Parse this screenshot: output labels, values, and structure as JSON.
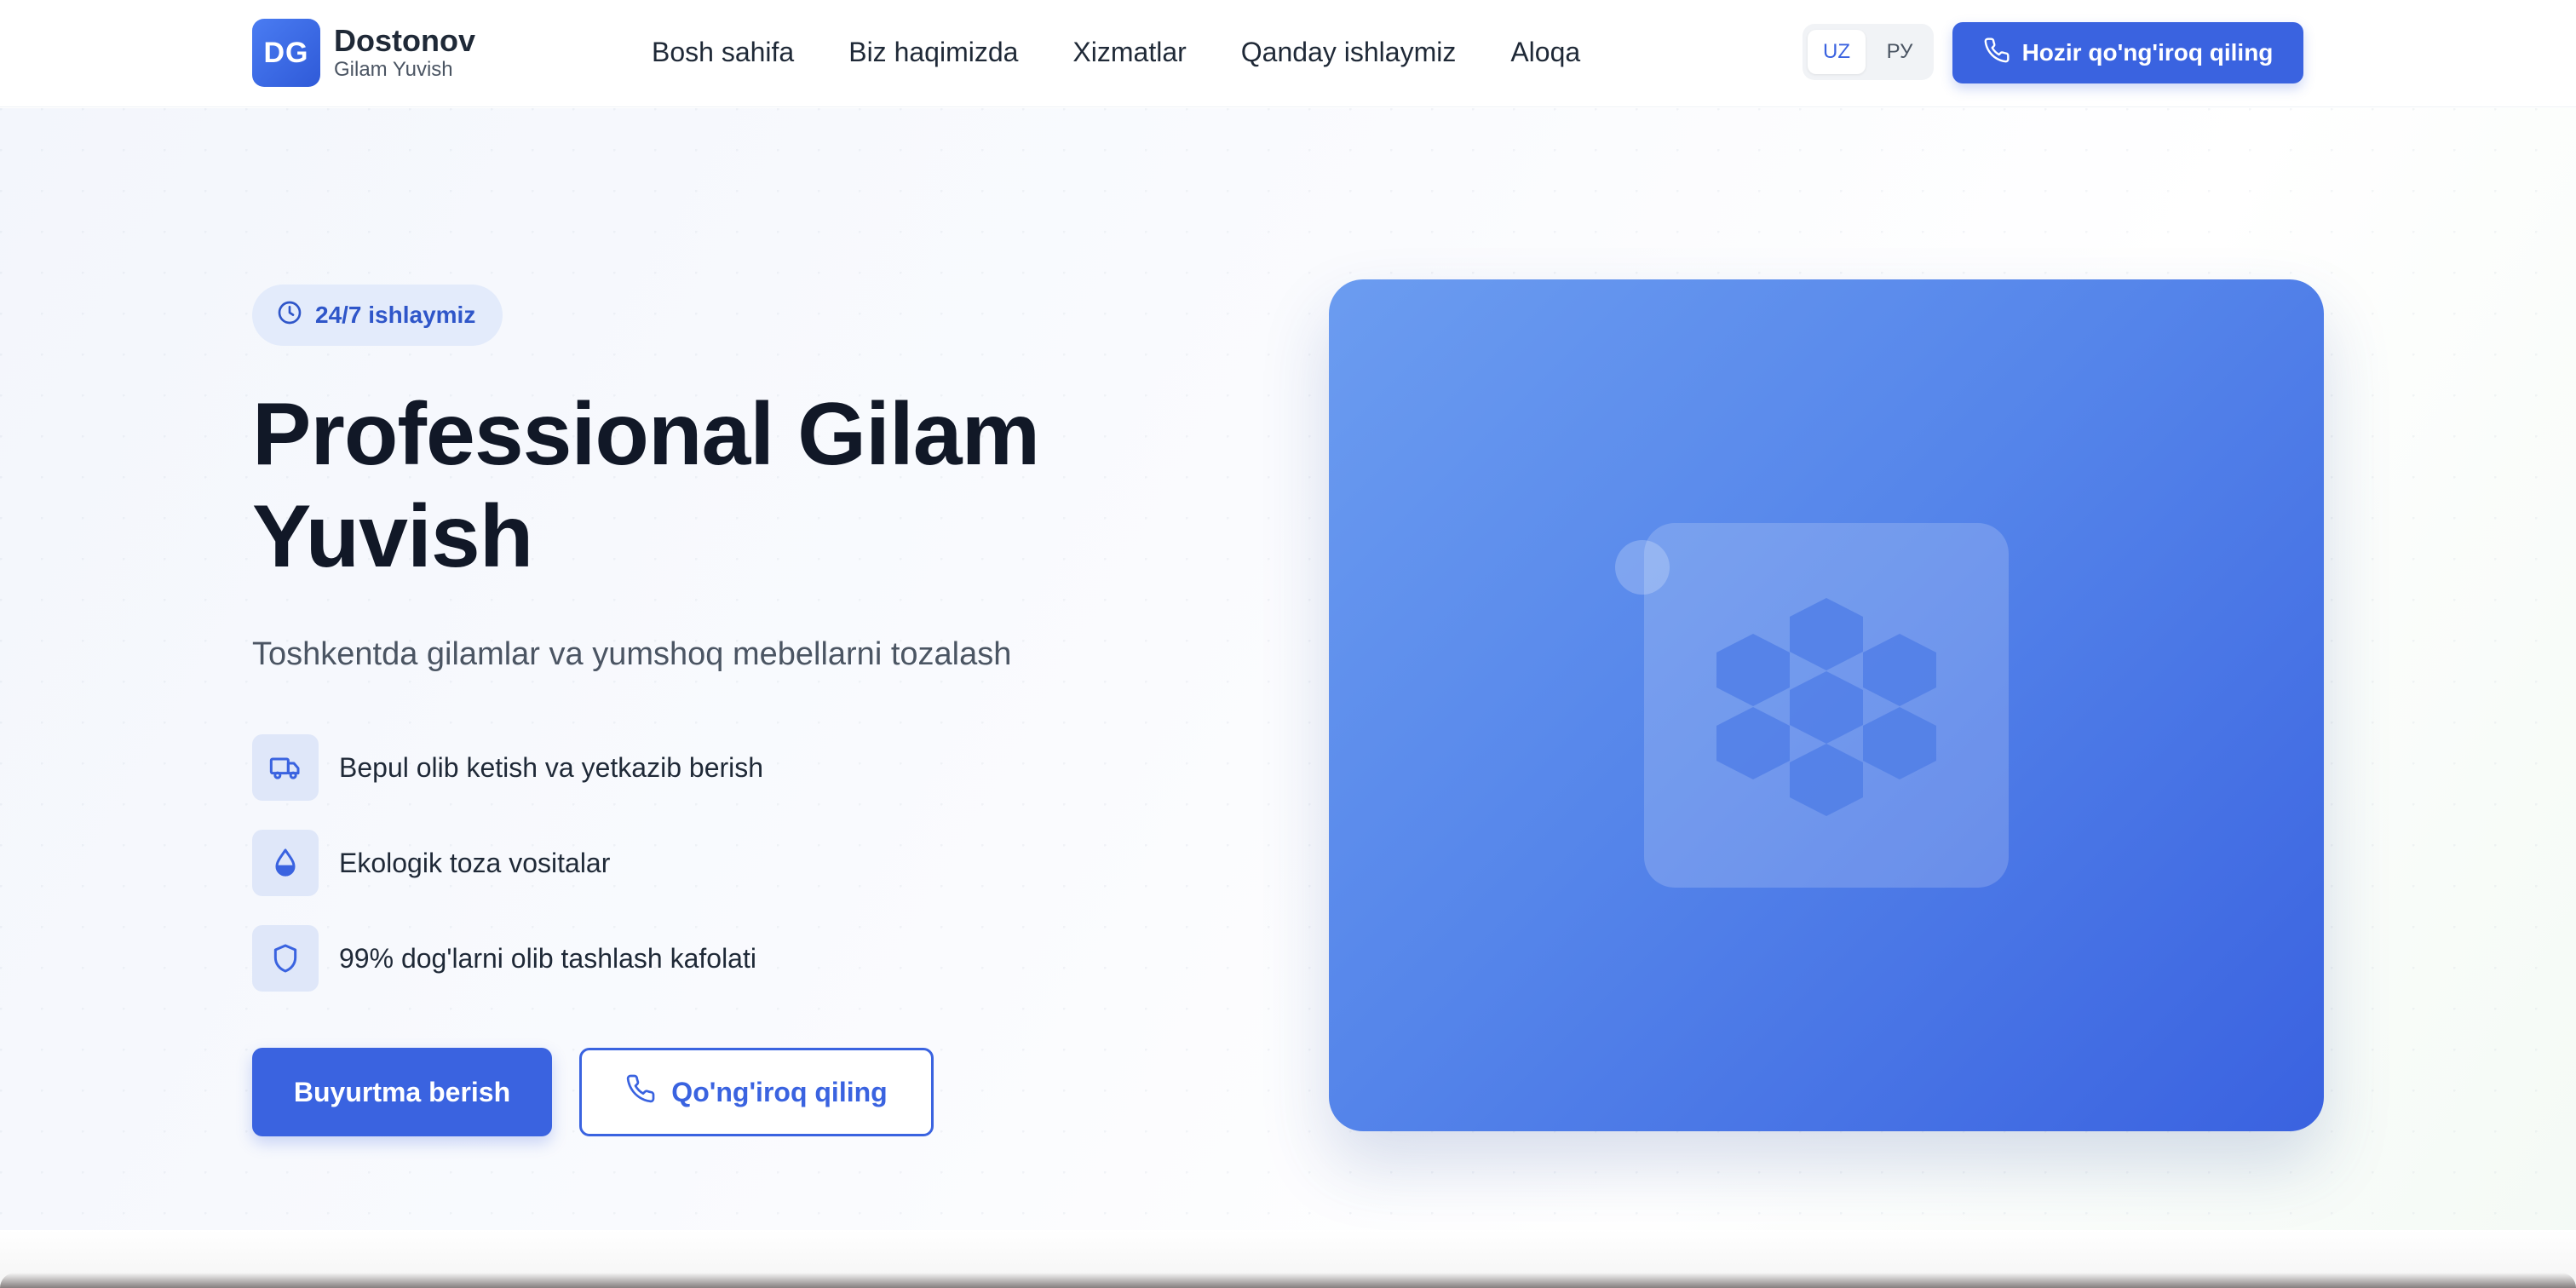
{
  "header": {
    "logo_initials": "DG",
    "logo_name": "Dostonov",
    "logo_sub": "Gilam Yuvish",
    "nav": [
      "Bosh sahifa",
      "Biz haqimizda",
      "Xizmatlar",
      "Qanday ishlaymiz",
      "Aloqa"
    ],
    "languages": [
      {
        "label": "UZ",
        "active": true
      },
      {
        "label": "РУ",
        "active": false
      }
    ],
    "call_now_label": "Hozir qo'ng'iroq qiling"
  },
  "hero": {
    "badge_label": "24/7 ishlaymiz",
    "title": "Professional Gilam Yuvish",
    "subtitle": "Toshkentda gilamlar va yumshoq mebellarni tozalash",
    "features": [
      {
        "icon": "truck-icon",
        "text": "Bepul olib ketish va yetkazib berish"
      },
      {
        "icon": "droplet-icon",
        "text": "Ekologik toza vositalar"
      },
      {
        "icon": "shield-icon",
        "text": "99% dog'larni olib tashlash kafolati"
      }
    ],
    "primary_button": "Buyurtma berish",
    "secondary_button": "Qo'ng'iroq qiling"
  },
  "colors": {
    "accent": "#3a63e0",
    "badge_bg": "#e3ebfb",
    "feature_icon_bg": "#dfe7f9",
    "title": "#111827"
  }
}
